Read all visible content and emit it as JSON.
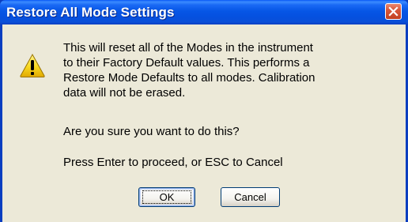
{
  "window": {
    "title": "Restore All Mode Settings"
  },
  "dialog": {
    "icon": "warning-icon",
    "message_lines": [
      "This will reset all of the Modes in the instrument",
      "to their Factory Default values.   This performs a",
      "Restore Mode Defaults to all modes.  Calibration",
      "data will not be erased."
    ],
    "question": "Are you sure you want to do this?",
    "instruction": "Press Enter to proceed, or ESC to Cancel"
  },
  "buttons": {
    "ok_label": "OK",
    "cancel_label": "Cancel"
  },
  "colors": {
    "titlebar": "#0550df",
    "client_background": "#ece9d8",
    "close_button": "#d8573a",
    "warning_yellow": "#f8d820"
  }
}
